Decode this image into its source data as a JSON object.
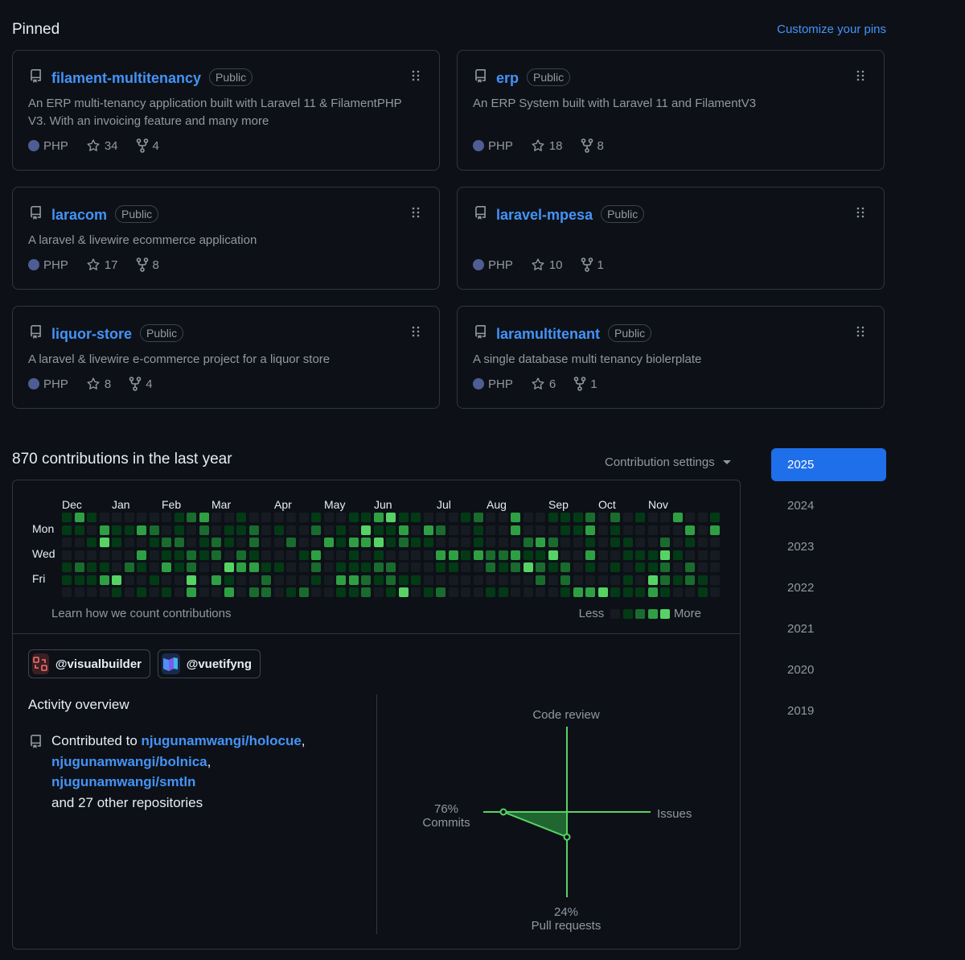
{
  "pinned": {
    "title": "Pinned",
    "customize_label": "Customize your pins",
    "cards": [
      {
        "name": "filament-multitenancy",
        "visibility": "Public",
        "description": "An ERP multi-tenancy application built with Laravel 11 & FilamentPHP V3. With an invoicing feature and many more",
        "language": "PHP",
        "stars": "34",
        "forks": "4"
      },
      {
        "name": "erp",
        "visibility": "Public",
        "description": "An ERP System built with Laravel 11 and FilamentV3",
        "language": "PHP",
        "stars": "18",
        "forks": "8"
      },
      {
        "name": "laracom",
        "visibility": "Public",
        "description": "A laravel & livewire ecommerce application",
        "language": "PHP",
        "stars": "17",
        "forks": "8"
      },
      {
        "name": "laravel-mpesa",
        "visibility": "Public",
        "description": "",
        "language": "PHP",
        "stars": "10",
        "forks": "1"
      },
      {
        "name": "liquor-store",
        "visibility": "Public",
        "description": "A laravel & livewire e-commerce project for a liquor store",
        "language": "PHP",
        "stars": "8",
        "forks": "4"
      },
      {
        "name": "laramultitenant",
        "visibility": "Public",
        "description": "A single database multi tenancy biolerplate",
        "language": "PHP",
        "stars": "6",
        "forks": "1"
      }
    ]
  },
  "contributions": {
    "title": "870 contributions in the last year",
    "settings_label": "Contribution settings",
    "months": [
      "Dec",
      "Jan",
      "Feb",
      "Mar",
      "Apr",
      "May",
      "Jun",
      "Jul",
      "Aug",
      "Sep",
      "Oct",
      "Nov"
    ],
    "days": [
      "Mon",
      "Wed",
      "Fri"
    ],
    "learn_label": "Learn how we count contributions",
    "legend_less": "Less",
    "legend_more": "More",
    "level_colors": [
      "#161b22",
      "#033a16",
      "#196c2e",
      "#2ea043",
      "#56d364"
    ]
  },
  "organizations": [
    {
      "handle": "@visualbuilder"
    },
    {
      "handle": "@vuetifyng"
    }
  ],
  "activity": {
    "title": "Activity overview",
    "contributed_prefix": "Contributed to ",
    "repos": [
      "njugunamwangi/holocue",
      "njugunamwangi/bolnica",
      "njugunamwangi/smtln"
    ],
    "others": "and 27 other repositories",
    "chart_data": {
      "type": "radar",
      "axes": [
        "Code review",
        "Issues",
        "Pull requests",
        "Commits"
      ],
      "values": {
        "Commits": 76,
        "Pull requests": 24,
        "Code review": 0,
        "Issues": 0
      },
      "labels": {
        "commits_pct": "76%",
        "commits": "Commits",
        "pr_pct": "24%",
        "pr": "Pull requests",
        "code_review": "Code review",
        "issues": "Issues"
      }
    }
  },
  "years": [
    "2025",
    "2024",
    "2023",
    "2022",
    "2021",
    "2020",
    "2019"
  ],
  "active_year": "2025"
}
